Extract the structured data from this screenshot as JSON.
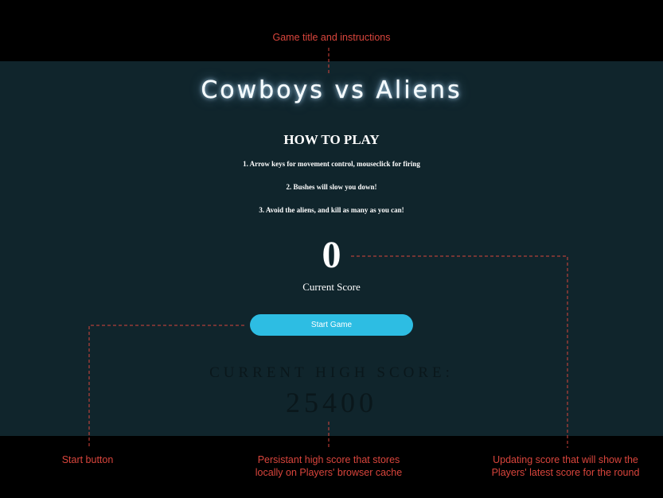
{
  "annotations": {
    "title_note": "Game title and instructions",
    "start_note": "Start button",
    "highscore_note_line1": "Persistant high score that stores",
    "highscore_note_line2": "locally on Players' browser cache",
    "score_note_line1": "Updating score that will show the",
    "score_note_line2": "Players'  latest score for the round",
    "color": "#d9453c"
  },
  "game": {
    "title": "Cowboys vs Aliens",
    "how_to_play_heading": "HOW TO PLAY",
    "instructions": [
      "1. Arrow keys for movement control, mouseclick for firing",
      "2. Bushes will slow you down!",
      "3. Avoid the aliens, and kill as many as you can!"
    ],
    "current_score": "0",
    "current_score_label": "Current Score",
    "start_button_label": "Start Game",
    "high_score_label": "CURRENT HIGH SCORE:",
    "high_score_value": "25400"
  },
  "colors": {
    "panel_background": "#10252c",
    "outer_background": "#000000",
    "button": "#2dbde3"
  }
}
